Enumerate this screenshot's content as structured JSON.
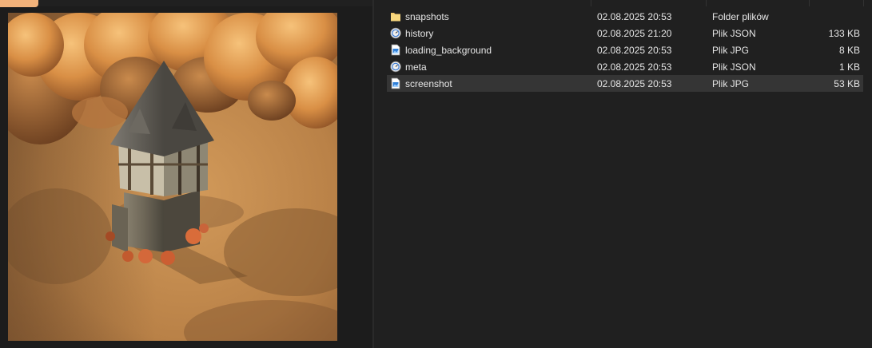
{
  "files": [
    {
      "name": "snapshots",
      "modified": "02.08.2025 20:53",
      "type": "Folder plików",
      "size": "",
      "icon": "folder-icon",
      "selected": false
    },
    {
      "name": "history",
      "modified": "02.08.2025 21:20",
      "type": "Plik JSON",
      "size": "133 KB",
      "icon": "json-file-icon",
      "selected": false
    },
    {
      "name": "loading_background",
      "modified": "02.08.2025 20:53",
      "type": "Plik JPG",
      "size": "8 KB",
      "icon": "jpg-file-icon",
      "selected": false
    },
    {
      "name": "meta",
      "modified": "02.08.2025 20:53",
      "type": "Plik JSON",
      "size": "1 KB",
      "icon": "json-file-icon",
      "selected": false
    },
    {
      "name": "screenshot",
      "modified": "02.08.2025 20:53",
      "type": "Plik JPG",
      "size": "53 KB",
      "icon": "jpg-file-icon",
      "selected": true
    }
  ],
  "colors": {
    "accent": "#f2b27a",
    "background": "#202020",
    "selected_row": "#353535",
    "text": "#e6e6e6"
  }
}
